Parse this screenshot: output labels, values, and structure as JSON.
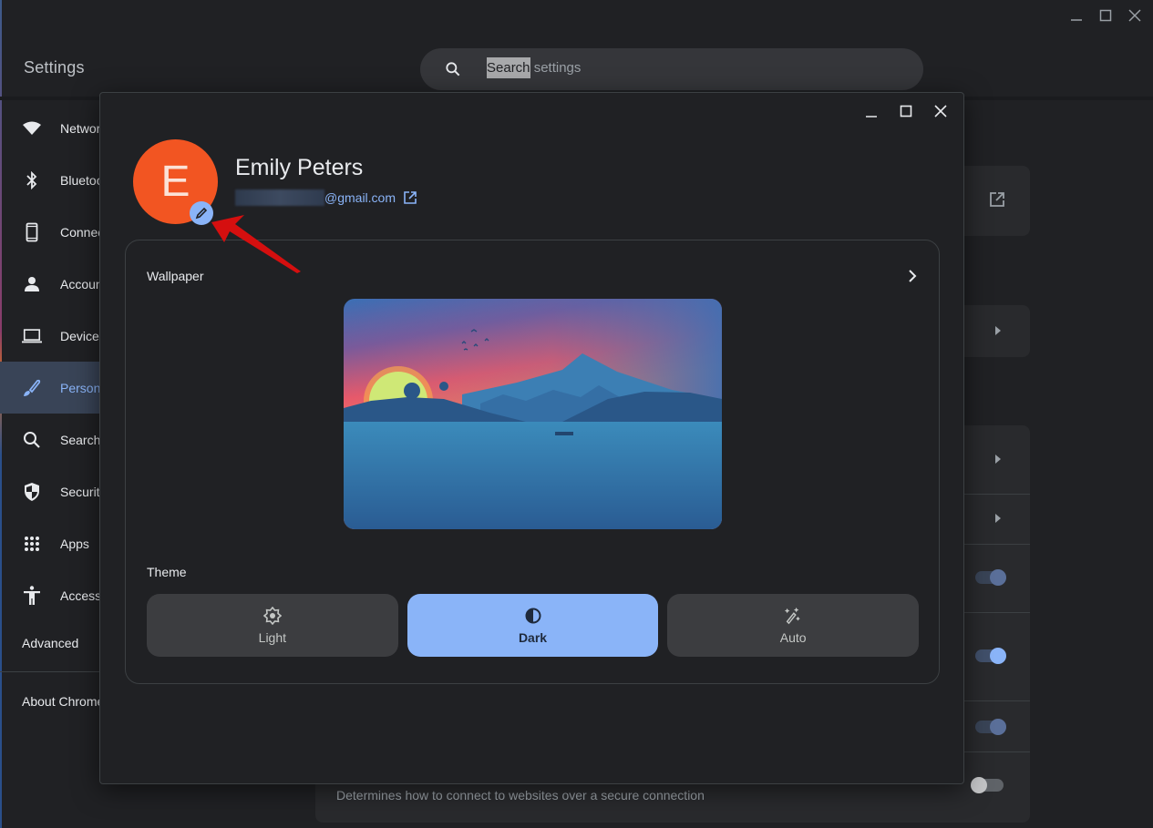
{
  "window": {
    "title": "Settings",
    "controls": [
      "minimize",
      "maximize",
      "close"
    ]
  },
  "search": {
    "placeholder": "Search settings",
    "selected_part": "Search",
    "rest": " settings"
  },
  "sidebar": {
    "items": [
      {
        "label": "Network",
        "icon": "wifi-icon",
        "active": false
      },
      {
        "label": "Bluetooth",
        "icon": "bluetooth-icon",
        "active": false
      },
      {
        "label": "Connected devices",
        "icon": "phone-icon",
        "active": false
      },
      {
        "label": "Accounts",
        "icon": "person-icon",
        "active": false
      },
      {
        "label": "Device",
        "icon": "laptop-icon",
        "active": false
      },
      {
        "label": "Personalization",
        "icon": "brush-icon",
        "active": true
      },
      {
        "label": "Search and Assistant",
        "icon": "search-icon",
        "active": false
      },
      {
        "label": "Security and Privacy",
        "icon": "shield-icon",
        "active": false
      },
      {
        "label": "Apps",
        "icon": "apps-grid-icon",
        "active": false
      },
      {
        "label": "Accessibility",
        "icon": "accessibility-icon",
        "active": false
      }
    ],
    "advanced": "Advanced",
    "about": "About ChromeOS"
  },
  "background": {
    "description": "Determines how to connect to websites over a secure connection",
    "toggles": [
      {
        "state": "on"
      },
      {
        "state": "on"
      },
      {
        "state": "on"
      },
      {
        "state": "off"
      }
    ]
  },
  "dialog": {
    "profile": {
      "avatar_letter": "E",
      "avatar_color": "#f25522",
      "name": "Emily Peters",
      "email_suffix": "@gmail.com"
    },
    "wallpaper": {
      "label": "Wallpaper",
      "preview": "Sunset lake and mountain landscape"
    },
    "theme": {
      "label": "Theme",
      "options": [
        {
          "label": "Light",
          "icon": "sun-icon",
          "selected": false
        },
        {
          "label": "Dark",
          "icon": "contrast-icon",
          "selected": true
        },
        {
          "label": "Auto",
          "icon": "magic-wand-icon",
          "selected": false
        }
      ]
    }
  },
  "colors": {
    "accent": "#8ab4f8",
    "background": "#202124",
    "annotation_arrow": "#d50f0f"
  }
}
